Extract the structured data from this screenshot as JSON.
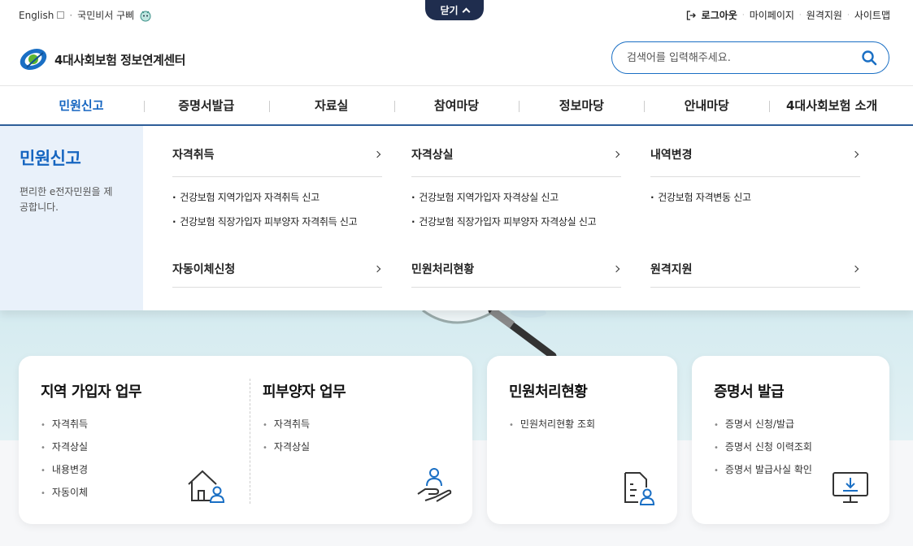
{
  "util": {
    "english": "English",
    "sep": "·",
    "secretary": "국민비서 구삐",
    "close": "닫기",
    "logout": "로그아웃",
    "mypage": "마이페이지",
    "remote": "원격지원",
    "sitemap": "사이트맵"
  },
  "header": {
    "logo_text": "4대사회보험 정보연계센터",
    "search_placeholder": "검색어를 입력해주세요."
  },
  "gnb": {
    "items": [
      "민원신고",
      "증명서발급",
      "자료실",
      "참여마당",
      "정보마당",
      "안내마당",
      "4대사회보험 소개"
    ]
  },
  "mega": {
    "title": "민원신고",
    "desc": "편리한 e전자민원을 제공합니다.",
    "col1": {
      "head": "자격취득",
      "subs": [
        "건강보험 지역가입자 자격취득 신고",
        "건강보험 직장가입자 피부양자 자격취득 신고"
      ],
      "head2": "자동이체신청"
    },
    "col2": {
      "head": "자격상실",
      "subs": [
        "건강보험 지역가입자 자격상실 신고",
        "건강보험 직장가입자 피부양자 자격상실 신고"
      ],
      "head2": "민원처리현황"
    },
    "col3": {
      "head": "내역변경",
      "subs": [
        "건강보험 자격변동 신고"
      ],
      "head2": "원격지원"
    }
  },
  "cards": {
    "regional": {
      "title": "지역 가입자 업무",
      "items": [
        "자격취득",
        "자격상실",
        "내용변경",
        "자동이체"
      ]
    },
    "dependent": {
      "title": "피부양자 업무",
      "items": [
        "자격취득",
        "자격상실"
      ]
    },
    "status": {
      "title": "민원처리현황",
      "items": [
        "민원처리현황 조회"
      ]
    },
    "certificate": {
      "title": "증명서 발급",
      "items": [
        "증명서 신청/발급",
        "증명서 신청 이력조회",
        "증명서 발급사실 확인"
      ]
    }
  },
  "colors": {
    "primary": "#1565c0",
    "navy": "#1f2d4e",
    "band": "#d5ebf0",
    "mega_side": "#e9f1fa"
  }
}
